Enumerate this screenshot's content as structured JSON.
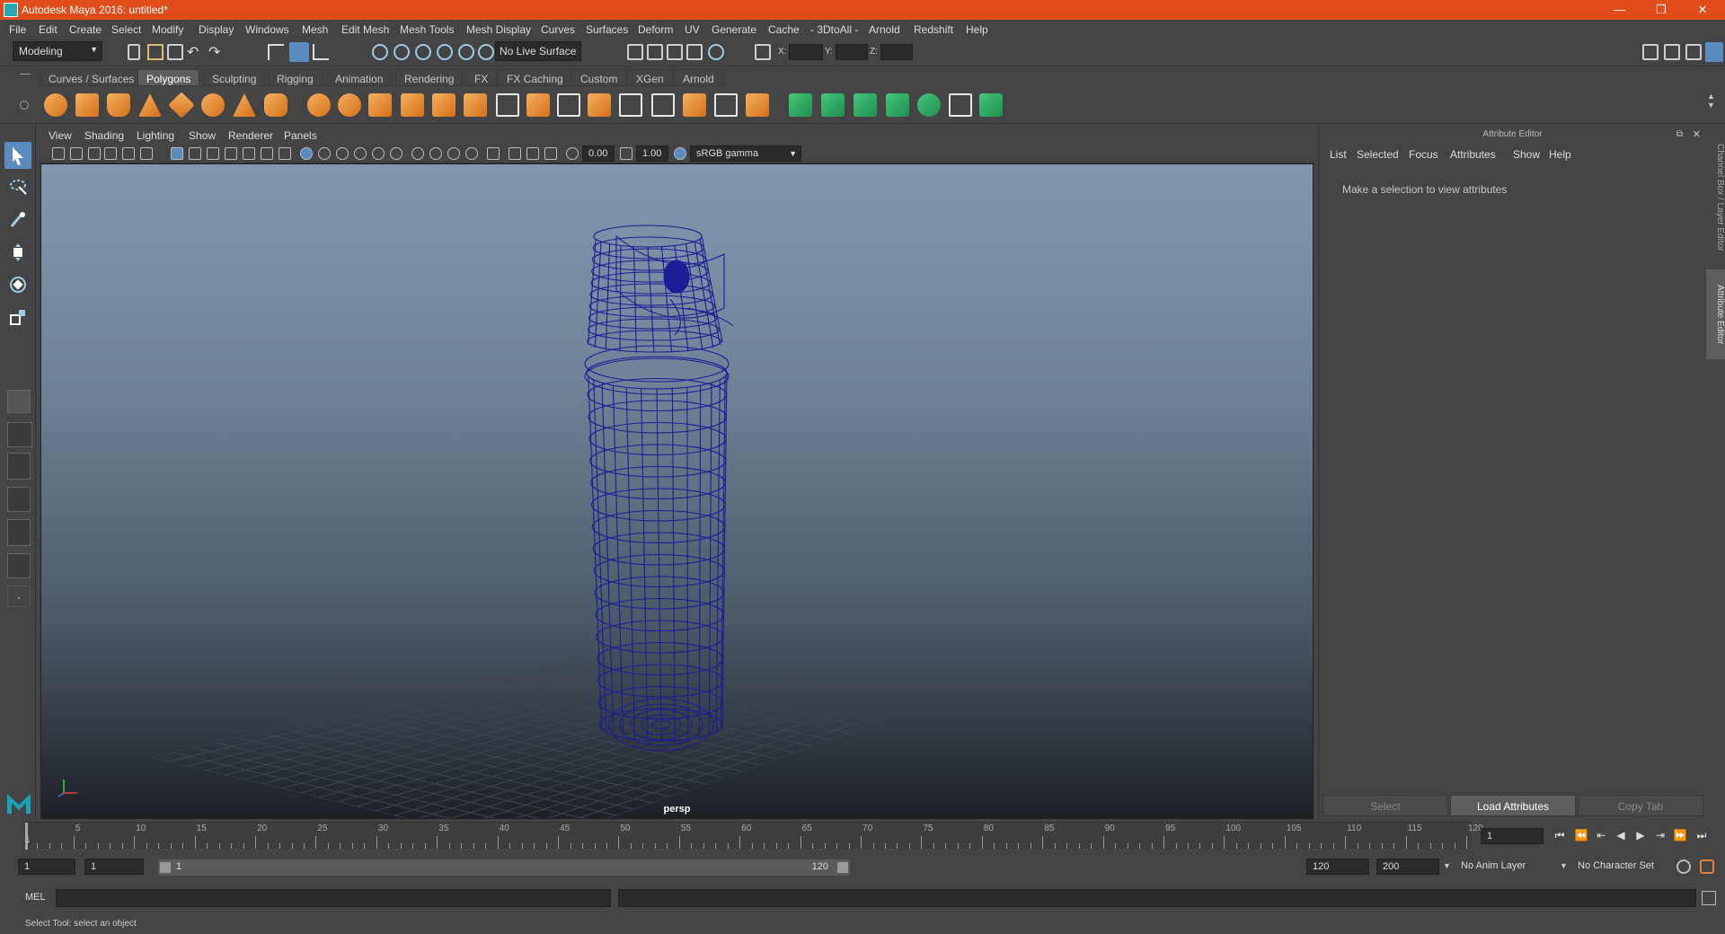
{
  "window": {
    "title": "Autodesk Maya 2016: untitled*",
    "min_glyph": "—",
    "max_glyph": "❐",
    "close_glyph": "✕",
    "colors": {
      "titlebar": "#e04d1b",
      "panel": "#444444",
      "wire": "#1a1a8c"
    }
  },
  "menubar": {
    "items": [
      "File",
      "Edit",
      "Create",
      "Select",
      "Modify",
      "Display",
      "Windows",
      "Mesh",
      "Edit Mesh",
      "Mesh Tools",
      "Mesh Display",
      "Curves",
      "Surfaces",
      "Deform",
      "UV",
      "Generate",
      "Cache",
      "- 3DtoAll -",
      "Arnold",
      "Redshift",
      "Help"
    ]
  },
  "statusline": {
    "mode": "Modeling",
    "live_surface": "No Live Surface",
    "x_label": "X:",
    "y_label": "Y:",
    "z_label": "Z:"
  },
  "shelf": {
    "tabs": [
      "Curves / Surfaces",
      "Polygons",
      "Sculpting",
      "Rigging",
      "Animation",
      "Rendering",
      "FX",
      "FX Caching",
      "Custom",
      "XGen",
      "Arnold"
    ],
    "active_tab": "Polygons"
  },
  "panel": {
    "menu": [
      "View",
      "Shading",
      "Lighting",
      "Show",
      "Renderer",
      "Panels"
    ],
    "exposure": "0.00",
    "gamma": "1.00",
    "color_space": "sRGB gamma",
    "camera": "persp"
  },
  "attribute_editor": {
    "header": "Attribute Editor",
    "menu": [
      "List",
      "Selected",
      "Focus",
      "Attributes",
      "Show",
      "Help"
    ],
    "message": "Make a selection to view attributes",
    "buttons": {
      "select": "Select",
      "load": "Load Attributes",
      "copy": "Copy Tab"
    },
    "side_tabs": [
      "Channel Box / Layer Editor",
      "Attribute Editor"
    ]
  },
  "timeline": {
    "tick_labels": [
      "5",
      "10",
      "15",
      "20",
      "25",
      "30",
      "35",
      "40",
      "45",
      "50",
      "55",
      "60",
      "65",
      "70",
      "75",
      "80",
      "85",
      "90",
      "95",
      "100",
      "105",
      "110",
      "115",
      "120"
    ],
    "start_label": "1",
    "current_frame": "1"
  },
  "range": {
    "start": "1",
    "playback_start": "1",
    "range_start_label": "1",
    "range_end_label": "120",
    "playback_end": "120",
    "end": "200",
    "anim_layer": "No Anim Layer",
    "character_set": "No Character Set"
  },
  "cmdline": {
    "label": "MEL"
  },
  "helpline": {
    "text": "Select Tool: select an object"
  },
  "toolbox": {
    "collapse": "-"
  }
}
